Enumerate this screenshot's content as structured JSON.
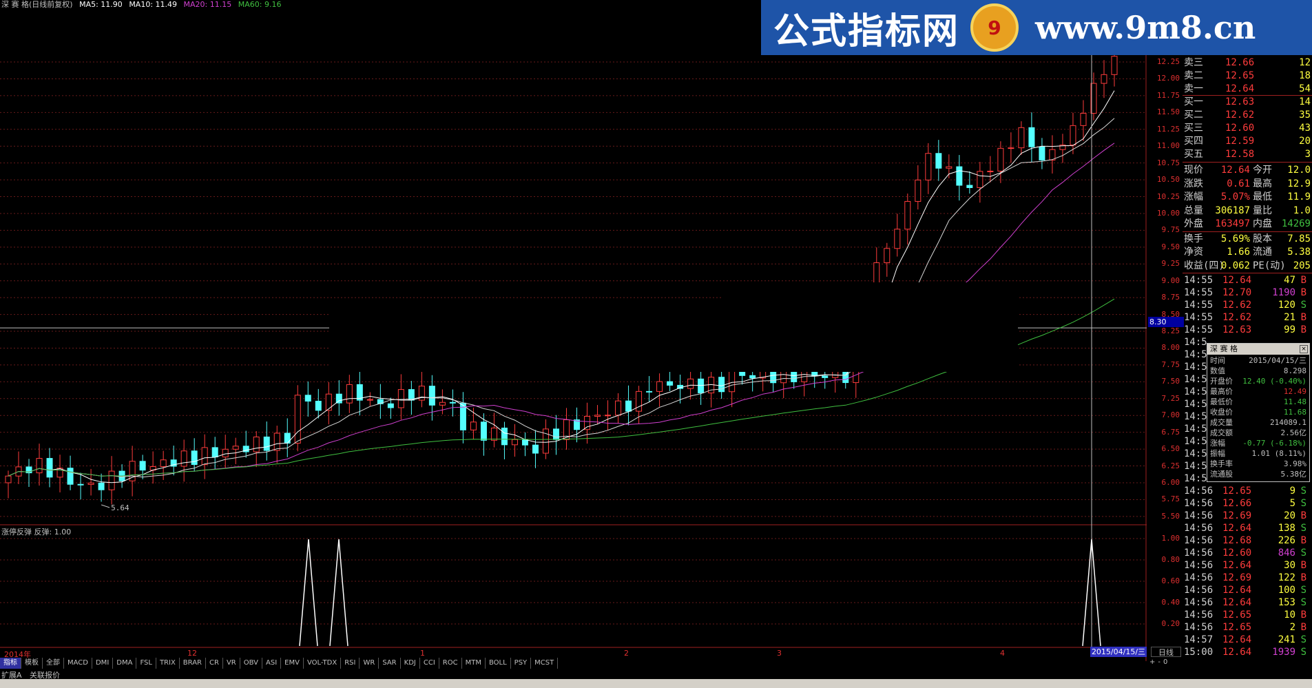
{
  "title_bar": {
    "stock": "深 赛 格",
    "mode": "(日线前复权)",
    "ma5": "MA5: 11.90",
    "ma10": "MA10: 11.49",
    "ma20": "MA20: 11.15",
    "ma60": "MA60: 9.16",
    "colors": {
      "ma5": "#ffffff",
      "ma10": "#ffffff",
      "ma20": "#d040d0",
      "ma60": "#40c040"
    }
  },
  "watermark": {
    "left": "公式指标网",
    "logo": "9",
    "right": "www.9m8.cn"
  },
  "price_axis": [
    "12.25",
    "12.00",
    "11.75",
    "11.50",
    "11.25",
    "11.00",
    "10.75",
    "10.50",
    "10.25",
    "10.00",
    "9.75",
    "9.50",
    "9.25",
    "9.00",
    "8.75",
    "8.50",
    "8.25",
    "8.00",
    "7.75",
    "7.50",
    "7.25",
    "7.00",
    "6.75",
    "6.50",
    "6.25",
    "6.00",
    "5.75",
    "5.50"
  ],
  "indicator_axis": [
    "1.00",
    "0.80",
    "0.60",
    "0.40",
    "0.20"
  ],
  "cursor_price": "8.30",
  "low_mark": "5.64",
  "indicator": {
    "label": "涨停反弹 反弹: 1.00"
  },
  "months": [
    {
      "label": "2014年"
    },
    {
      "label": "12"
    },
    {
      "label": "1"
    },
    {
      "label": "2"
    },
    {
      "label": "3"
    },
    {
      "label": "4"
    }
  ],
  "cursor_date": "2015/04/15/三",
  "period": "日线",
  "tabs": [
    "指标",
    "模板",
    "全部",
    "MACD",
    "DMI",
    "DMA",
    "FSL",
    "TRIX",
    "BRAR",
    "CR",
    "VR",
    "OBV",
    "ASI",
    "EMV",
    "VOL-TDX",
    "RSI",
    "WR",
    "SAR",
    "KDJ",
    "CCI",
    "ROC",
    "MTM",
    "BOLL",
    "PSY",
    "MCST"
  ],
  "status": [
    "扩展A",
    "关联报价"
  ],
  "zoom": [
    "+",
    "-",
    "0"
  ],
  "order_book": [
    {
      "label": "卖三",
      "price": "12.66",
      "vol": "12"
    },
    {
      "label": "卖二",
      "price": "12.65",
      "vol": "18"
    },
    {
      "label": "卖一",
      "price": "12.64",
      "vol": "54"
    },
    {
      "label": "买一",
      "price": "12.63",
      "vol": "14"
    },
    {
      "label": "买二",
      "price": "12.62",
      "vol": "35"
    },
    {
      "label": "买三",
      "price": "12.60",
      "vol": "43"
    },
    {
      "label": "买四",
      "price": "12.59",
      "vol": "20"
    },
    {
      "label": "买五",
      "price": "12.58",
      "vol": "3"
    }
  ],
  "quote": [
    {
      "l1": "现价",
      "v1": "12.64",
      "l2": "今开",
      "v2": "12.0"
    },
    {
      "l1": "涨跌",
      "v1": "0.61",
      "l2": "最高",
      "v2": "12.9"
    },
    {
      "l1": "涨幅",
      "v1": "5.07%",
      "l2": "最低",
      "v2": "11.9"
    },
    {
      "l1": "总量",
      "v1": "306187",
      "l2": "量比",
      "v2": "1.0"
    },
    {
      "l1": "外盘",
      "v1": "163497",
      "l2": "内盘",
      "v2": "14269"
    },
    {
      "l1": "换手",
      "v1": "5.69%",
      "l2": "股本",
      "v2": "7.85"
    },
    {
      "l1": "净资",
      "v1": "1.66",
      "l2": "流通",
      "v2": "5.38"
    },
    {
      "l1": "收益(四)",
      "v1": "0.062",
      "l2": "PE(动)",
      "v2": "205"
    }
  ],
  "ticks": [
    {
      "t": "14:55",
      "p": "12.64",
      "v": "47",
      "s": "B"
    },
    {
      "t": "14:55",
      "p": "12.70",
      "v": "1190",
      "s": "B"
    },
    {
      "t": "14:55",
      "p": "12.62",
      "v": "120",
      "s": "S"
    },
    {
      "t": "14:55",
      "p": "12.62",
      "v": "21",
      "s": "B"
    },
    {
      "t": "14:55",
      "p": "12.63",
      "v": "99",
      "s": "B"
    },
    {
      "t": "14:5",
      "p": "",
      "v": "",
      "s": ""
    },
    {
      "t": "14:5",
      "p": "",
      "v": "",
      "s": ""
    },
    {
      "t": "14:5",
      "p": "",
      "v": "",
      "s": ""
    },
    {
      "t": "14:5",
      "p": "",
      "v": "",
      "s": ""
    },
    {
      "t": "14:5",
      "p": "",
      "v": "",
      "s": ""
    },
    {
      "t": "14:5",
      "p": "",
      "v": "",
      "s": ""
    },
    {
      "t": "14:5",
      "p": "",
      "v": "",
      "s": ""
    },
    {
      "t": "14:5",
      "p": "",
      "v": "",
      "s": ""
    },
    {
      "t": "14:5",
      "p": "",
      "v": "",
      "s": ""
    },
    {
      "t": "14:5",
      "p": "",
      "v": "",
      "s": ""
    },
    {
      "t": "14:5",
      "p": "",
      "v": "",
      "s": ""
    },
    {
      "t": "14:56",
      "p": "12.64",
      "v": "10",
      "s": "S"
    },
    {
      "t": "14:56",
      "p": "12.65",
      "v": "9",
      "s": "S"
    },
    {
      "t": "14:56",
      "p": "12.66",
      "v": "5",
      "s": "S"
    },
    {
      "t": "14:56",
      "p": "12.69",
      "v": "20",
      "s": "B"
    },
    {
      "t": "14:56",
      "p": "12.64",
      "v": "138",
      "s": "S"
    },
    {
      "t": "14:56",
      "p": "12.68",
      "v": "226",
      "s": "B"
    },
    {
      "t": "14:56",
      "p": "12.60",
      "v": "846",
      "s": "S"
    },
    {
      "t": "14:56",
      "p": "12.64",
      "v": "30",
      "s": "B"
    },
    {
      "t": "14:56",
      "p": "12.69",
      "v": "122",
      "s": "B"
    },
    {
      "t": "14:56",
      "p": "12.64",
      "v": "100",
      "s": "S"
    },
    {
      "t": "14:56",
      "p": "12.64",
      "v": "153",
      "s": "S"
    },
    {
      "t": "14:56",
      "p": "12.65",
      "v": "10",
      "s": "B"
    },
    {
      "t": "14:56",
      "p": "12.65",
      "v": "2",
      "s": "B"
    },
    {
      "t": "14:57",
      "p": "12.64",
      "v": "241",
      "s": "S"
    },
    {
      "t": "15:00",
      "p": "12.64",
      "v": "1939",
      "s": "S"
    }
  ],
  "popup": {
    "title": "深 赛 格",
    "rows": [
      {
        "l": "时间",
        "v": "2015/04/15/三",
        "c": "#c0c0c0"
      },
      {
        "l": "数值",
        "v": "8.298",
        "c": "#c0c0c0"
      },
      {
        "l": "开盘价",
        "v": "12.40 (-0.40%)",
        "c": "#40c040"
      },
      {
        "l": "最高价",
        "v": "12.49",
        "c": "#e03030"
      },
      {
        "l": "最低价",
        "v": "11.48",
        "c": "#40c040"
      },
      {
        "l": "收盘价",
        "v": "11.68",
        "c": "#40c040"
      },
      {
        "l": "成交量",
        "v": "214089.1",
        "c": "#c0c0c0"
      },
      {
        "l": "成交额",
        "v": "2.56亿",
        "c": "#c0c0c0"
      },
      {
        "l": "涨幅",
        "v": "-0.77 (-6.18%)",
        "c": "#40c040"
      },
      {
        "l": "振幅",
        "v": "1.01 (8.11%)",
        "c": "#c0c0c0"
      },
      {
        "l": "换手率",
        "v": "3.98%",
        "c": "#c0c0c0"
      },
      {
        "l": "流通股",
        "v": "5.38亿",
        "c": "#c0c0c0"
      }
    ]
  }
}
